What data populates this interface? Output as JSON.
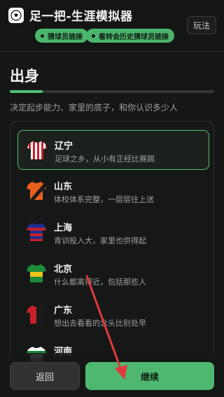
{
  "header": {
    "app_title": "足一把-生涯模拟器",
    "howto_label": "玩法",
    "links": [
      {
        "label": "猜球员链接"
      },
      {
        "label": "看转会历史猜球员链接"
      }
    ]
  },
  "page": {
    "title": "出身",
    "subtitle": "决定起步能力、家里的底子，和你认识多少人",
    "progress": 0.16
  },
  "provinces": [
    {
      "name": "辽宁",
      "desc": "足球之乡，从小有正经比赛踢",
      "selected": true,
      "icon": "red-white-striped-jersey-icon"
    },
    {
      "name": "山东",
      "desc": "体校体系完整，一层层往上送",
      "selected": false,
      "icon": "orange-black-jersey-icon"
    },
    {
      "name": "上海",
      "desc": "青训投入大，家里也供得起",
      "selected": false,
      "icon": "blue-red-striped-jersey-icon"
    },
    {
      "name": "北京",
      "desc": "什么都离得近，包括那些人",
      "selected": false,
      "icon": "green-yellow-jersey-icon"
    },
    {
      "name": "广东",
      "desc": "想出去看看的念头比别处早",
      "selected": false,
      "icon": "red-black-jersey-icon"
    },
    {
      "name": "河南",
      "desc": "",
      "selected": false,
      "icon": "green-white-jersey-icon"
    }
  ],
  "footer": {
    "back_label": "返回",
    "continue_label": "继续"
  },
  "colors": {
    "accent": "#4fbf74",
    "background": "#151716",
    "arrow": "#e0393e"
  }
}
